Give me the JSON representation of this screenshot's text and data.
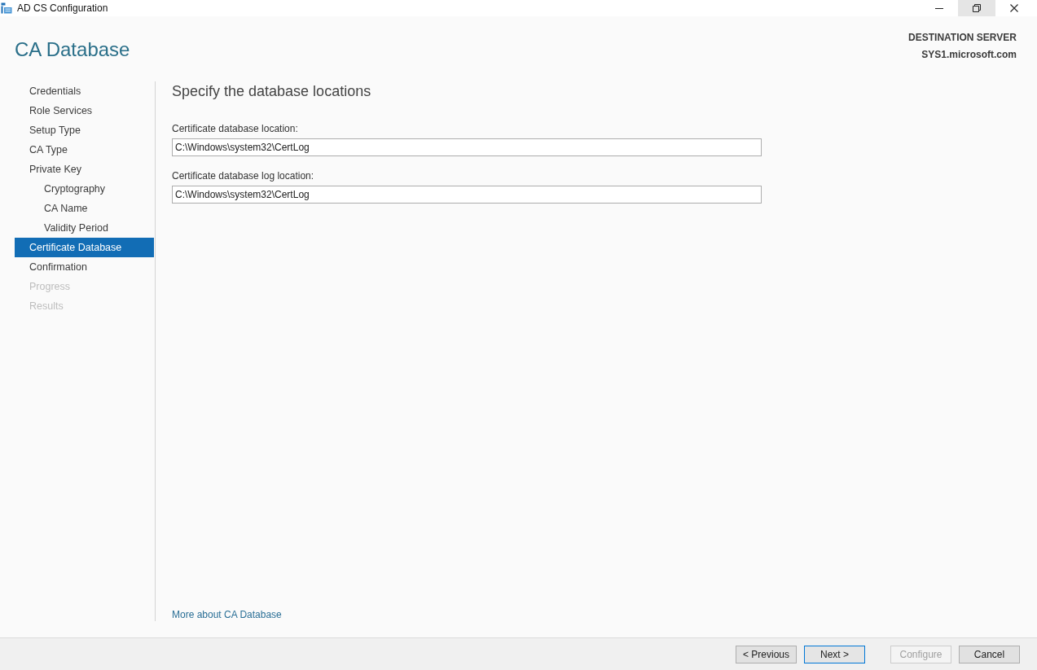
{
  "window": {
    "title": "AD CS Configuration",
    "controls": [
      {
        "kind": "minimize",
        "hovered": false
      },
      {
        "kind": "restore",
        "hovered": true
      },
      {
        "kind": "close",
        "hovered": false
      }
    ]
  },
  "header": {
    "page_title": "CA Database",
    "destination_label": "DESTINATION SERVER",
    "destination_server": "SYS1.microsoft.com"
  },
  "nav": {
    "items": [
      {
        "label": "Credentials",
        "selected": false,
        "disabled": false
      },
      {
        "label": "Role Services",
        "selected": false,
        "disabled": false
      },
      {
        "label": "Setup Type",
        "selected": false,
        "disabled": false
      },
      {
        "label": "CA Type",
        "selected": false,
        "disabled": false
      },
      {
        "label": "Private Key",
        "selected": false,
        "disabled": false,
        "children": [
          {
            "label": "Cryptography",
            "selected": false,
            "disabled": false
          },
          {
            "label": "CA Name",
            "selected": false,
            "disabled": false
          },
          {
            "label": "Validity Period",
            "selected": false,
            "disabled": false
          }
        ]
      },
      {
        "label": "Certificate Database",
        "selected": true,
        "disabled": false
      },
      {
        "label": "Confirmation",
        "selected": false,
        "disabled": false
      },
      {
        "label": "Progress",
        "selected": false,
        "disabled": true
      },
      {
        "label": "Results",
        "selected": false,
        "disabled": true
      }
    ]
  },
  "content": {
    "heading": "Specify the database locations",
    "fields": [
      {
        "label": "Certificate database location:",
        "value": "C:\\Windows\\system32\\CertLog"
      },
      {
        "label": "Certificate database log location:",
        "value": "C:\\Windows\\system32\\CertLog"
      }
    ],
    "link": "More about CA Database"
  },
  "footer": {
    "nav_buttons": [
      {
        "label": "< Previous",
        "default": false,
        "disabled": false
      },
      {
        "label": "Next >",
        "default": true,
        "disabled": false
      }
    ],
    "action_buttons": [
      {
        "label": "Configure",
        "default": false,
        "disabled": true
      },
      {
        "label": "Cancel",
        "default": false,
        "disabled": false
      }
    ]
  }
}
